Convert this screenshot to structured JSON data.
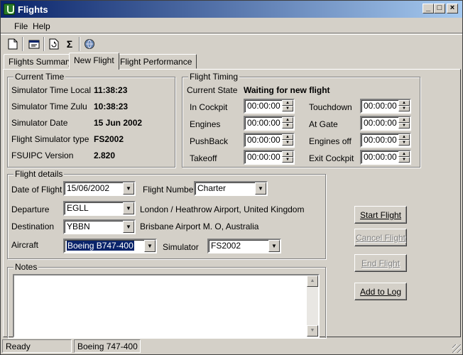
{
  "window": {
    "title": "Flights"
  },
  "menu": {
    "file": "File",
    "help": "Help"
  },
  "toolbar": {
    "icons": [
      "new-icon",
      "properties-icon",
      "refresh-icon",
      "sigma-icon",
      "globe-icon"
    ],
    "sigma_glyph": "Σ"
  },
  "tabs": [
    {
      "label": "Flights Summary",
      "active": false
    },
    {
      "label": "New Flight",
      "active": true
    },
    {
      "label": "Flight Performance",
      "active": false
    }
  ],
  "current_time": {
    "legend": "Current Time",
    "rows": [
      {
        "label": "Simulator Time Local",
        "value": "11:38:23"
      },
      {
        "label": "Simulator Time Zulu",
        "value": "10:38:23"
      },
      {
        "label": "Simulator Date",
        "value": "15 Jun 2002"
      },
      {
        "label": "Flight Simulator type",
        "value": "FS2002"
      },
      {
        "label": "FSUIPC Version",
        "value": "2.820"
      }
    ]
  },
  "flight_timing": {
    "legend": "Flight Timing",
    "state_label": "Current State",
    "state_value": "Waiting for new flight",
    "left": [
      {
        "label": "In Cockpit",
        "value": "00:00:00"
      },
      {
        "label": "Engines",
        "value": "00:00:00"
      },
      {
        "label": "PushBack",
        "value": "00:00:00"
      },
      {
        "label": "Takeoff",
        "value": "00:00:00"
      }
    ],
    "right": [
      {
        "label": "Touchdown",
        "value": "00:00:00"
      },
      {
        "label": "At Gate",
        "value": "00:00:00"
      },
      {
        "label": "Engines off",
        "value": "00:00:00"
      },
      {
        "label": "Exit Cockpit",
        "value": "00:00:00"
      }
    ]
  },
  "flight_details": {
    "legend": "Flight details",
    "date_label": "Date of Flight",
    "date_value": "15/06/2002",
    "flight_number_label": "Flight Number",
    "flight_number_value": "Charter",
    "departure_label": "Departure",
    "departure_value": "EGLL",
    "departure_name": "London / Heathrow Airport, United Kingdom",
    "destination_label": "Destination",
    "destination_value": "YBBN",
    "destination_name": "Brisbane Airport M. O, Australia",
    "aircraft_label": "Aircraft",
    "aircraft_value": "Boeing B747-400",
    "simulator_label": "Simulator",
    "simulator_value": "FS2002"
  },
  "notes": {
    "legend": "Notes",
    "text": ""
  },
  "buttons": {
    "start": "Start Flight",
    "cancel": "Cancel Flight",
    "end": "End Flight",
    "add_log": "Add to Log"
  },
  "status": {
    "left": "Ready",
    "right": "Boeing 747-400"
  },
  "colors": {
    "titlebar_start": "#0a246a",
    "titlebar_end": "#a6caf0",
    "face": "#d4d0c8"
  }
}
